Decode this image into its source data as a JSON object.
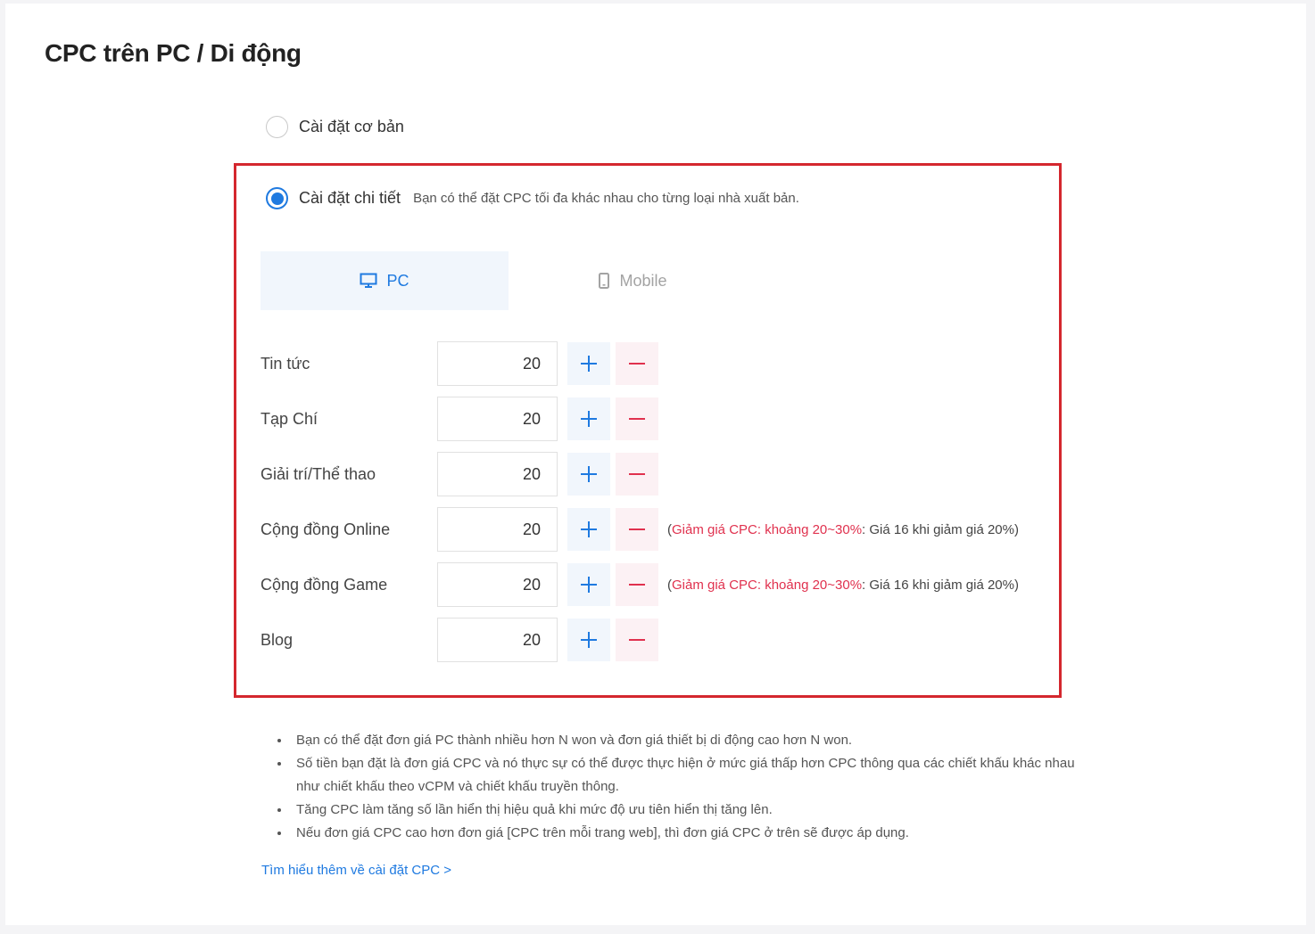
{
  "header": {
    "title": "CPC trên PC / Di động"
  },
  "options": {
    "basic": {
      "label": "Cài đặt cơ bản",
      "checked": false
    },
    "detailed": {
      "label": "Cài đặt chi tiết",
      "description": "Bạn có thể đặt CPC tối đa khác nhau cho từng loại nhà xuất bản.",
      "checked": true
    }
  },
  "tabs": [
    {
      "label": "PC",
      "icon": "monitor-icon",
      "active": true
    },
    {
      "label": "Mobile",
      "icon": "mobile-icon",
      "active": false
    }
  ],
  "rows": [
    {
      "label": "Tin tức",
      "value": "20",
      "hint_red": "",
      "hint_rest": ""
    },
    {
      "label": "Tạp Chí",
      "value": "20",
      "hint_red": "",
      "hint_rest": ""
    },
    {
      "label": "Giải trí/Thể thao",
      "value": "20",
      "hint_red": "",
      "hint_rest": ""
    },
    {
      "label": "Cộng đồng Online",
      "value": "20",
      "hint_red": "Giảm giá CPC: khoảng 20~30%",
      "hint_rest": ": Giá 16 khi giảm giá 20%)"
    },
    {
      "label": "Cộng đồng Game",
      "value": "20",
      "hint_red": "Giảm giá CPC: khoảng 20~30%",
      "hint_rest": ": Giá 16 khi giảm giá 20%)"
    },
    {
      "label": "Blog",
      "value": "20",
      "hint_red": "",
      "hint_rest": ""
    }
  ],
  "hint_open": "(",
  "notes": [
    "Bạn có thể đặt đơn giá PC thành nhiều hơn N won và đơn giá thiết bị di động cao hơn N won.",
    "Số tiền bạn đặt là đơn giá CPC và nó thực sự có thể được thực hiện ở mức giá thấp hơn CPC thông qua các chiết khấu khác nhau như chiết khấu theo vCPM và chiết khấu truyền thông.",
    "Tăng CPC làm tăng số lần hiển thị hiệu quả khi mức độ ưu tiên hiển thị tăng lên.",
    "Nếu đơn giá CPC cao hơn đơn giá [CPC trên mỗi trang web], thì đơn giá CPC ở trên sẽ được áp dụng."
  ],
  "learn_more": "Tìm hiểu thêm về cài đặt CPC >",
  "colors": {
    "accent": "#1f7ae0",
    "danger": "#e0314e",
    "highlight_border": "#d4272e"
  }
}
